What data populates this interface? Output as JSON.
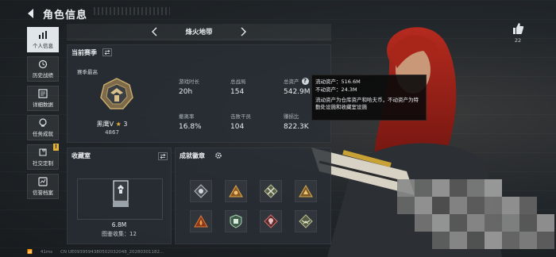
{
  "header": {
    "title": "角色信息"
  },
  "sidebar": {
    "items": [
      {
        "label": "个人信息",
        "icon": "bar-chart-icon"
      },
      {
        "label": "历史战绩",
        "icon": "history-icon"
      },
      {
        "label": "详细数据",
        "icon": "detail-icon"
      },
      {
        "label": "任务成就",
        "icon": "trophy-icon"
      },
      {
        "label": "社交定制",
        "icon": "puzzle-icon",
        "badge": "!"
      },
      {
        "label": "信誉档案",
        "icon": "credit-icon"
      }
    ]
  },
  "map": {
    "name": "烽火地带"
  },
  "season": {
    "title": "当前赛季",
    "highest_label": "赛季最高",
    "rank_name": "黑鹰V",
    "rank_stars": "3",
    "rank_score": "4867",
    "stats": [
      {
        "label": "游戏时长",
        "value": "20h"
      },
      {
        "label": "总战局",
        "value": "154"
      },
      {
        "label": "总资产",
        "value": "542.9M",
        "help": true
      },
      {
        "label": "撤离率",
        "value": "16.8%"
      },
      {
        "label": "击败干员",
        "value": "104"
      },
      {
        "label": "赚损比",
        "value": "822.3K"
      }
    ]
  },
  "tooltip": {
    "line1": "流动资产：516.6M",
    "line2": "不动资产：24.3M",
    "line3": "流动资产为仓库资产和哈夫币，不动资产为特勤处设施和收藏室设施"
  },
  "collection": {
    "title": "收藏室",
    "value": "6.8M",
    "count_label": "图鉴收集：",
    "count": "12"
  },
  "achievements": {
    "title": "成就徽章"
  },
  "like": {
    "count": "22"
  },
  "footer": {
    "ping": "41ms",
    "build": "CN UE0939594380502032048_20280301182..."
  },
  "colors": {
    "accent": "#e0b23b",
    "active_tab": "#dfe5e9",
    "panel": "#282e34"
  }
}
